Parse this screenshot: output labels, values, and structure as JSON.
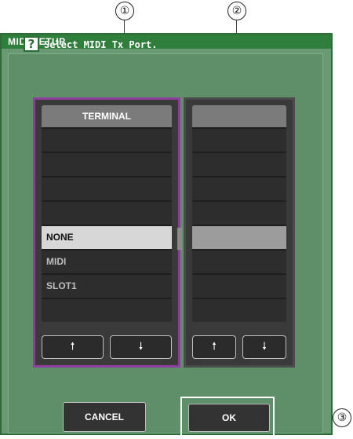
{
  "callouts": [
    "①",
    "②",
    "③"
  ],
  "window": {
    "title": "MIDI SETUP",
    "help_icon": "?",
    "prompt": "Select MIDI Tx Port."
  },
  "left_list": {
    "header": "TERMINAL",
    "rows": [
      "",
      "",
      "",
      "",
      "NONE",
      "MIDI",
      "SLOT1",
      "",
      ""
    ],
    "selected_index": 4
  },
  "right_list": {
    "header": "",
    "rows": [
      "",
      "",
      "",
      "",
      "",
      "",
      "",
      "",
      ""
    ],
    "selected_index": 4
  },
  "arrows": {
    "up": "🠕",
    "down": "🠗"
  },
  "buttons": {
    "cancel": "CANCEL",
    "ok": "OK"
  },
  "colors": {
    "window_bg": "#6a9a74",
    "title_bg": "#2f7e3c",
    "left_frame": "#8e3f9d",
    "selected_row": "#d7d7d7"
  },
  "icons": [
    "help-icon",
    "arrow-up-icon",
    "arrow-down-icon"
  ]
}
